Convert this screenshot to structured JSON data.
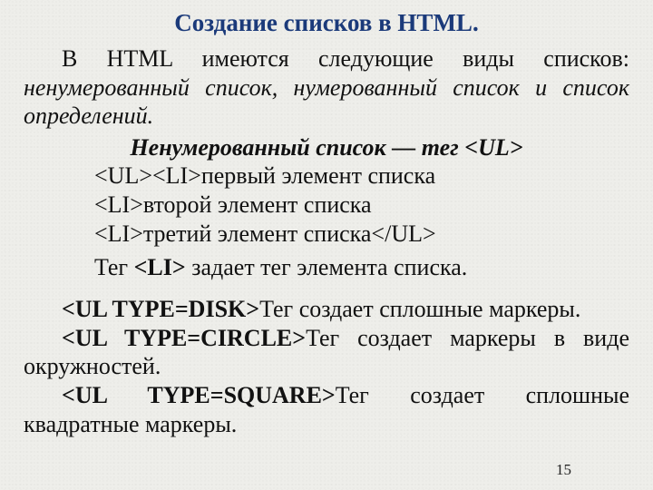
{
  "title": "Создание списков в HTML.",
  "intro": {
    "lead": "В HTML имеются следующие виды списков: ",
    "types": "ненумерованный список, нумерованный список и список определений."
  },
  "unordered": {
    "heading": "Ненумерованный список — тег <UL>",
    "lines": [
      "<UL><LI>первый элемент списка",
      "<LI>второй элемент списка",
      "<LI>третий элемент списка</UL>"
    ],
    "li_desc_pre": "Тег ",
    "li_tag": "<LI>",
    "li_desc_post": " задает тег элемента списка."
  },
  "types": {
    "disk_tag": "<UL TYPE=DISK>",
    "disk_desc": "Тег создает сплошные маркеры.",
    "circle_tag": "<UL TYPE=CIRCLE>",
    "circle_desc": "Тег создает маркеры в виде окружностей.",
    "square_tag": "<UL TYPE=SQUARE>",
    "square_desc": "Тег создает сплошные квадратные маркеры."
  },
  "page_number": "15"
}
